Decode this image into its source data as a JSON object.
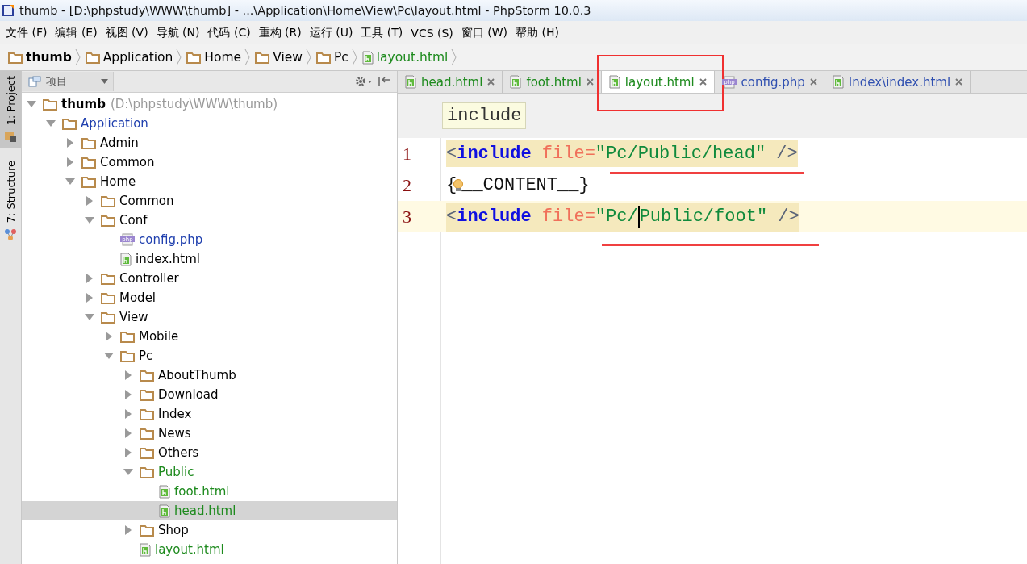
{
  "window": {
    "title": "thumb - [D:\\phpstudy\\WWW\\thumb] - ...\\Application\\Home\\View\\Pc\\layout.html - PhpStorm 10.0.3"
  },
  "menu": [
    "文件 (F)",
    "编辑 (E)",
    "视图 (V)",
    "导航 (N)",
    "代码 (C)",
    "重构 (R)",
    "运行 (U)",
    "工具 (T)",
    "VCS (S)",
    "窗口 (W)",
    "帮助 (H)"
  ],
  "breadcrumbs": [
    {
      "label": "thumb",
      "kind": "folder",
      "bold": true,
      "color": "#000000"
    },
    {
      "label": "Application",
      "kind": "folder",
      "bold": false,
      "color": "#000000"
    },
    {
      "label": "Home",
      "kind": "folder",
      "bold": false,
      "color": "#000000"
    },
    {
      "label": "View",
      "kind": "folder",
      "bold": false,
      "color": "#000000"
    },
    {
      "label": "Pc",
      "kind": "folder",
      "bold": false,
      "color": "#000000"
    },
    {
      "label": "layout.html",
      "kind": "html",
      "bold": false,
      "color": "#1d8a1d"
    }
  ],
  "side_tabs": [
    {
      "label": "1: Project",
      "kind": "project",
      "selected": true
    },
    {
      "label": "7: Structure",
      "kind": "structure",
      "selected": false
    }
  ],
  "project_panel": {
    "title": "项目",
    "tree": {
      "label": "thumb",
      "hint": "(D:\\phpstudy\\WWW\\thumb)",
      "kind": "folder",
      "bold": true,
      "color": "#000000",
      "expanded": true,
      "selected": false,
      "children": [
        {
          "label": "Application",
          "kind": "folder",
          "color": "#1f3fae",
          "expanded": true,
          "selected": false,
          "children": [
            {
              "label": "Admin",
              "kind": "folder",
              "color": "#000000",
              "expanded": false,
              "selected": false
            },
            {
              "label": "Common",
              "kind": "folder",
              "color": "#000000",
              "expanded": false,
              "selected": false
            },
            {
              "label": "Home",
              "kind": "folder",
              "color": "#000000",
              "expanded": true,
              "selected": false,
              "children": [
                {
                  "label": "Common",
                  "kind": "folder",
                  "color": "#000000",
                  "expanded": false,
                  "selected": false
                },
                {
                  "label": "Conf",
                  "kind": "folder",
                  "color": "#000000",
                  "expanded": true,
                  "selected": false,
                  "children": [
                    {
                      "label": "config.php",
                      "kind": "php",
                      "color": "#1f3fae",
                      "selected": false
                    },
                    {
                      "label": "index.html",
                      "kind": "html",
                      "color": "#000000",
                      "selected": false
                    }
                  ]
                },
                {
                  "label": "Controller",
                  "kind": "folder",
                  "color": "#000000",
                  "expanded": false,
                  "selected": false
                },
                {
                  "label": "Model",
                  "kind": "folder",
                  "color": "#000000",
                  "expanded": false,
                  "selected": false
                },
                {
                  "label": "View",
                  "kind": "folder",
                  "color": "#000000",
                  "expanded": true,
                  "selected": false,
                  "children": [
                    {
                      "label": "Mobile",
                      "kind": "folder",
                      "color": "#000000",
                      "expanded": false,
                      "selected": false
                    },
                    {
                      "label": "Pc",
                      "kind": "folder",
                      "color": "#000000",
                      "expanded": true,
                      "selected": false,
                      "children": [
                        {
                          "label": "AboutThumb",
                          "kind": "folder",
                          "color": "#000000",
                          "expanded": false,
                          "selected": false
                        },
                        {
                          "label": "Download",
                          "kind": "folder",
                          "color": "#000000",
                          "expanded": false,
                          "selected": false
                        },
                        {
                          "label": "Index",
                          "kind": "folder",
                          "color": "#000000",
                          "expanded": false,
                          "selected": false
                        },
                        {
                          "label": "News",
                          "kind": "folder",
                          "color": "#000000",
                          "expanded": false,
                          "selected": false
                        },
                        {
                          "label": "Others",
                          "kind": "folder",
                          "color": "#000000",
                          "expanded": false,
                          "selected": false
                        },
                        {
                          "label": "Public",
                          "kind": "folder",
                          "color": "#1d8a1d",
                          "expanded": true,
                          "selected": false,
                          "children": [
                            {
                              "label": "foot.html",
                              "kind": "html",
                              "color": "#1d8a1d",
                              "selected": false
                            },
                            {
                              "label": "head.html",
                              "kind": "html",
                              "color": "#1d8a1d",
                              "selected": true
                            }
                          ]
                        },
                        {
                          "label": "Shop",
                          "kind": "folder",
                          "color": "#000000",
                          "expanded": false,
                          "selected": false
                        },
                        {
                          "label": "layout.html",
                          "kind": "html",
                          "color": "#1d8a1d",
                          "selected": false
                        }
                      ]
                    }
                  ]
                }
              ]
            }
          ]
        }
      ]
    }
  },
  "tabs": [
    {
      "label": "head.html",
      "kind": "html",
      "color": "#1d8a1d",
      "selected": false
    },
    {
      "label": "foot.html",
      "kind": "html",
      "color": "#1d8a1d",
      "selected": false
    },
    {
      "label": "layout.html",
      "kind": "html",
      "color": "#1d8a1d",
      "selected": true
    },
    {
      "label": "config.php",
      "kind": "php",
      "color": "#2f4fb0",
      "selected": false
    },
    {
      "label": "Index\\index.html",
      "kind": "html",
      "color": "#2f4fb0",
      "selected": false
    }
  ],
  "editor": {
    "tag_hint": "include",
    "lines": [
      {
        "number": "1",
        "highlighted": true,
        "current": false,
        "underlined": true,
        "bulb": false,
        "tokens": [
          {
            "kind": "punct",
            "text": "<"
          },
          {
            "kind": "tag",
            "text": "include"
          },
          {
            "kind": "attr",
            "text": " file="
          },
          {
            "kind": "string",
            "text": "\"Pc/Public/head\""
          },
          {
            "kind": "punct",
            "text": " />"
          }
        ]
      },
      {
        "number": "2",
        "highlighted": false,
        "current": false,
        "underlined": false,
        "bulb": true,
        "tokens": [
          {
            "kind": "text",
            "text": "{"
          },
          {
            "kind": "text",
            "text": "__CONTENT__}"
          }
        ]
      },
      {
        "number": "3",
        "highlighted": true,
        "current": true,
        "underlined": true,
        "bulb": false,
        "tokens": [
          {
            "kind": "punct",
            "text": "<"
          },
          {
            "kind": "tag",
            "text": "include"
          },
          {
            "kind": "attr",
            "text": " file="
          },
          {
            "kind": "string",
            "text": "\"Pc/"
          },
          {
            "kind": "string",
            "text": "Public/foot\"",
            "caret": true
          },
          {
            "kind": "punct",
            "text": " />"
          }
        ]
      }
    ]
  }
}
